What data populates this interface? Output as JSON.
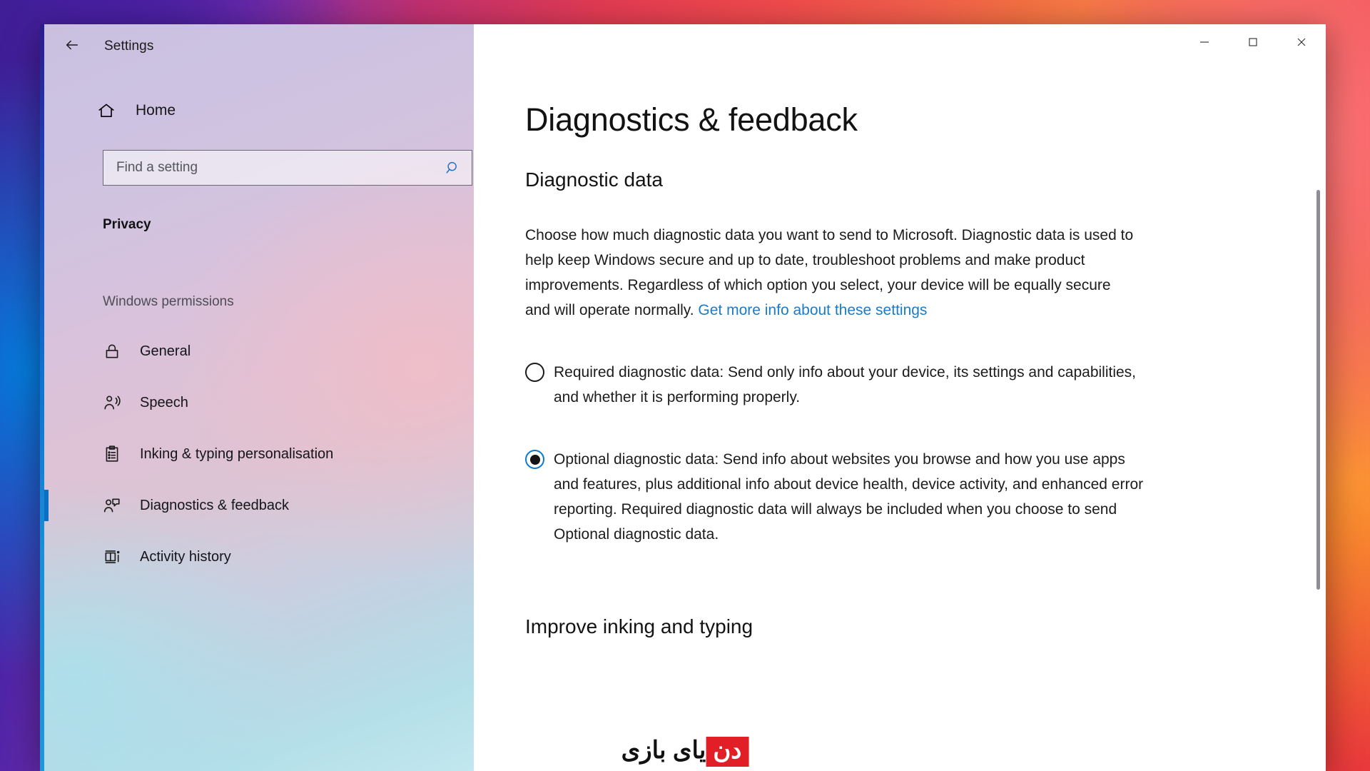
{
  "window": {
    "app_title": "Settings",
    "back_icon": "back-arrow-icon",
    "controls": {
      "minimize_label": "Minimise",
      "maximize_label": "Maximise",
      "close_label": "Close"
    }
  },
  "sidebar": {
    "home_label": "Home",
    "home_icon": "home-icon",
    "search": {
      "placeholder": "Find a setting",
      "value": "",
      "icon": "search-icon"
    },
    "category_heading": "Privacy",
    "group_label": "Windows permissions",
    "items": [
      {
        "label": "General",
        "icon": "lock-icon",
        "selected": false
      },
      {
        "label": "Speech",
        "icon": "speech-person-icon",
        "selected": false
      },
      {
        "label": "Inking & typing personalisation",
        "icon": "clipboard-list-icon",
        "selected": false
      },
      {
        "label": "Diagnostics & feedback",
        "icon": "person-feedback-icon",
        "selected": true
      },
      {
        "label": "Activity history",
        "icon": "activity-history-icon",
        "selected": false
      }
    ]
  },
  "main": {
    "page_title": "Diagnostics & feedback",
    "section_heading": "Diagnostic data",
    "intro_text": "Choose how much diagnostic data you want to send to Microsoft. Diagnostic data is used to help keep Windows secure and up to date, troubleshoot problems and make product improvements. Regardless of which option you select, your device will be equally secure and will operate normally. ",
    "intro_link_text": "Get more info about these settings",
    "options": [
      {
        "label": "Required diagnostic data: Send only info about your device, its settings and capabilities, and whether it is performing properly.",
        "selected": false
      },
      {
        "label": "Optional diagnostic data: Send info about websites you browse and how you use apps and features, plus additional info about device health, device activity, and enhanced error reporting. Required diagnostic data will always be included when you choose to send Optional diagnostic data.",
        "selected": true
      }
    ],
    "next_section_heading": "Improve inking and typing"
  },
  "watermark": {
    "badge_text": "دن",
    "text": "یای بازی"
  },
  "colors": {
    "accent": "#0a7ad1",
    "link": "#1a7bc9",
    "selection_bar": "#0b6fc4",
    "watermark_red": "#e21f26"
  }
}
